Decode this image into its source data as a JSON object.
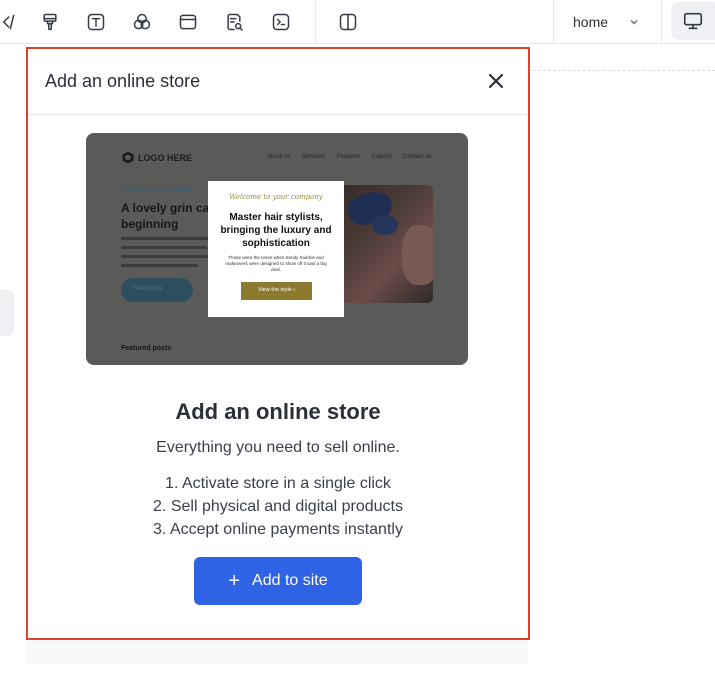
{
  "toolbar": {
    "icons": [
      "code-icon",
      "brush-icon",
      "text-icon",
      "shapes-icon",
      "section-icon",
      "page-search-icon",
      "terminal-icon",
      "layout-split-icon",
      "desktop-icon",
      "chevron-down-icon"
    ],
    "page_select_value": "home"
  },
  "dialog": {
    "title": "Add an online store",
    "preview": {
      "logo": "LOGO HERE",
      "nav": [
        "About us",
        "Services",
        "Features",
        "Experts",
        "Contact us"
      ],
      "kicker": "Welcome to your company",
      "headline_line1": "A lovely grin ca",
      "headline_line2": "beginning",
      "read_more": "Read more",
      "featured": "Featured posts",
      "card_script": "Welcome to your company",
      "card_title": "Master hair stylists, bringing the luxury and sophistication",
      "card_desc": "Those were the times when trendy hairdos and makeovers were designed to show off it was a big deal.",
      "card_cta": "View the style ›"
    },
    "heading": "Add an online store",
    "subheading": "Everything you need to sell online.",
    "steps": [
      "1. Activate store in a single click",
      "2. Sell physical and digital products",
      "3. Accept online payments instantly"
    ],
    "add_button_label": "Add to site",
    "add_button_icon": "plus-icon",
    "accent_color": "#2f63e6",
    "highlight_border_color": "#d9442c"
  }
}
